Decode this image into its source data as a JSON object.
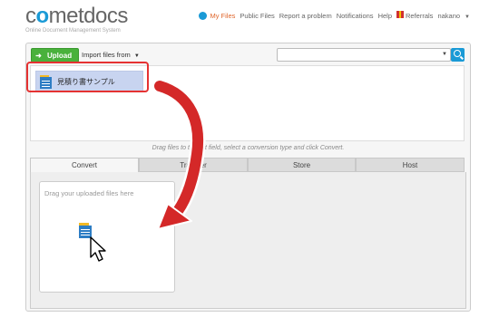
{
  "brand": {
    "logo_text_1": "c",
    "logo_text_2": "o",
    "logo_text_3": "metdocs",
    "tagline": "Online Document Management System"
  },
  "nav": {
    "my_files": "My Files",
    "public_files": "Public Files",
    "report": "Report a problem",
    "notifications": "Notifications",
    "help": "Help",
    "referrals": "Referrals",
    "user": "nakano"
  },
  "toolbar": {
    "upload_label": "Upload",
    "import_label": "Import files from"
  },
  "files": [
    {
      "name": "見積り書サンプル"
    }
  ],
  "hint": "Drag files to the left field, select a conversion type and click Convert.",
  "tabs": [
    {
      "label": "Convert"
    },
    {
      "label": "Transfer"
    },
    {
      "label": "Store"
    },
    {
      "label": "Host"
    }
  ],
  "convert": {
    "drop_placeholder": "Drag your uploaded files here"
  },
  "colors": {
    "accent": "#1a9ad6",
    "active_nav": "#e0662c",
    "upload_green": "#49b13c",
    "annotation_red": "#e53232"
  }
}
